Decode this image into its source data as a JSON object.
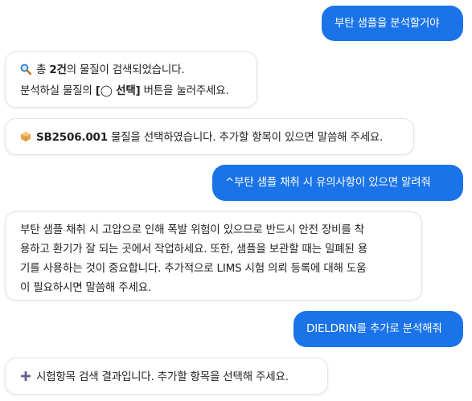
{
  "messages": {
    "m1": {
      "text": "부탄 샘플을 분석할거야"
    },
    "m2": {
      "icon": "search-icon",
      "prefix": "총 ",
      "count": "2건",
      "suffix": "의 물질이 검색되었습니다.",
      "line2_prefix": "분석하실 물질의 ",
      "button_ref": "[◯ 선택]",
      "line2_suffix": " 버튼을 눌러주세요."
    },
    "m3": {
      "icon": "package-icon",
      "code": "SB2506.001",
      "text": " 물질을 선택하였습니다. 추가할 항목이 있으면 말씀해 주세요."
    },
    "m4": {
      "text": "^부탄 샘플 채취 시 유의사항이 있으면 알려줘"
    },
    "m5": {
      "line1": "부탄 샘플 채취 시 고압으로 인해 폭발 위험이 있으므로 반드시 안전 장비를 착",
      "line2": "용하고 환기가 잘 되는 곳에서 작업하세요. 또한, 샘플을 보관할 때는 밀폐된 용",
      "line3": "기를 사용하는 것이 중요합니다. 추가적으로 LIMS 시험 의뢰 등록에 대해 도움",
      "line4": "이 필요하시면 말씀해 주세요."
    },
    "m6": {
      "text": "DIELDRIN를 추가로 분석해줘"
    },
    "m7": {
      "icon": "plus-icon",
      "text": "시험항목 검색 결과입니다. 추가할 항목을 선택해 주세요."
    }
  }
}
